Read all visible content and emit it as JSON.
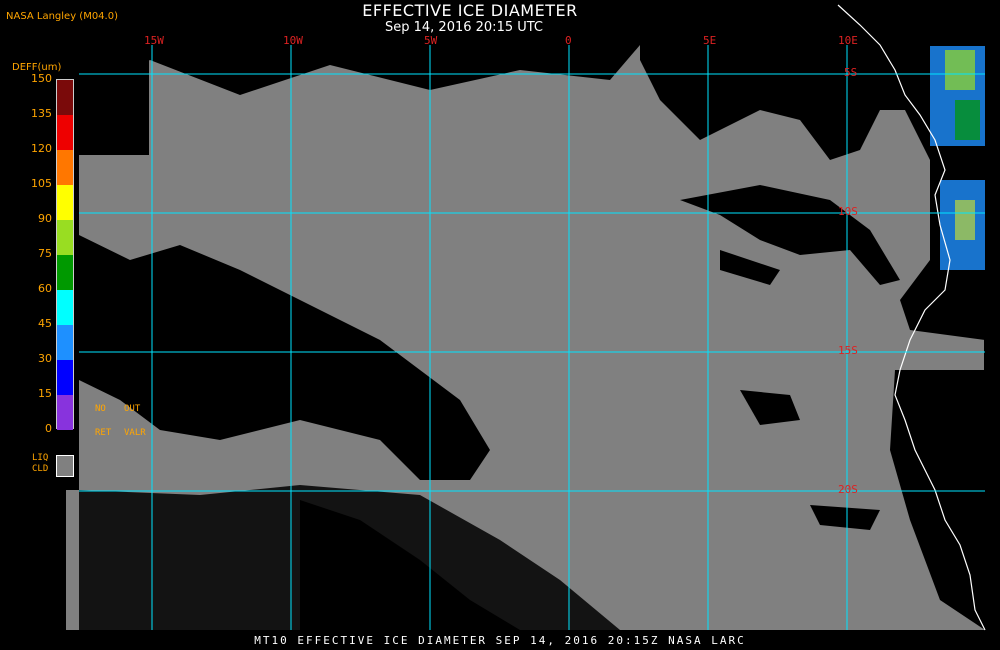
{
  "header": {
    "producer": "NASA Langley (M04.0)",
    "title": "EFFECTIVE ICE DIAMETER",
    "subtitle": "Sep 14, 2016 20:15 UTC"
  },
  "legend": {
    "title": "DEFF(um)",
    "ticks": [
      "150",
      "135",
      "120",
      "105",
      "90",
      "75",
      "60",
      "45",
      "30",
      "15",
      "0"
    ],
    "colors": [
      "#7a0a0a",
      "#ee0000",
      "#ff7700",
      "#ffff00",
      "#99dd22",
      "#009900",
      "#00ffff",
      "#1e90ff",
      "#0000ff",
      "#8833dd"
    ],
    "no_ret": [
      "NO",
      "RET"
    ],
    "out_valr": [
      "OUT",
      "VALR"
    ],
    "liq_cld": [
      "LIQ",
      "CLD"
    ],
    "liq_color": "#808080"
  },
  "grid": {
    "lon_labels": [
      "15W",
      "10W",
      "5W",
      "0",
      "5E",
      "10E"
    ],
    "lat_labels": [
      "5S",
      "10S",
      "15S",
      "20S"
    ],
    "line_color": "#00e5ff",
    "label_color": "#dd2222"
  },
  "map_colors": {
    "liquid_cloud": "#808080",
    "clear": "#000000",
    "coastline": "#ffffff"
  },
  "footer": "MT10  EFFECTIVE ICE DIAMETER  SEP 14, 2016 20:15Z  NASA LARC"
}
